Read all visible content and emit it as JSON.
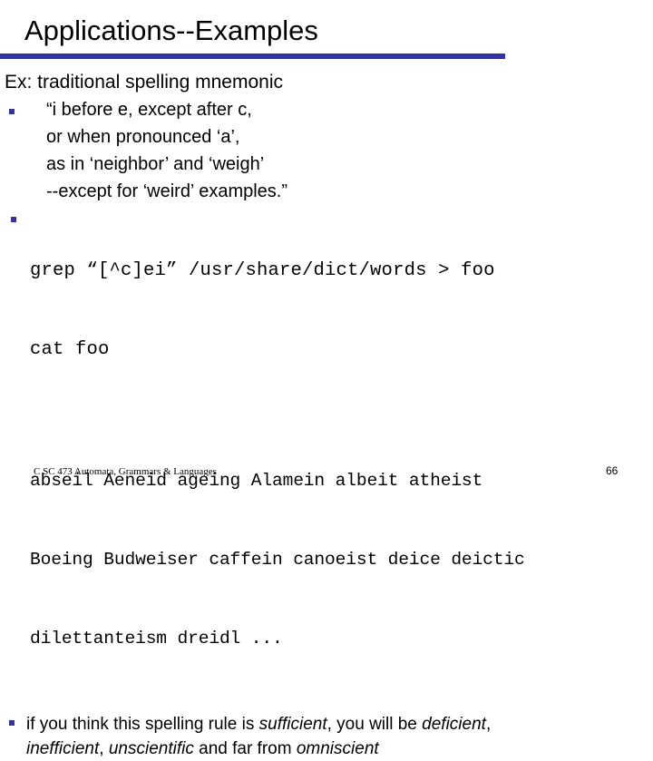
{
  "slide": {
    "title": "Applications--Examples",
    "accent_color": "#3333a6",
    "bullet_color": "#33339c",
    "lead_line": "Ex:  traditional spelling mnemonic",
    "mnemonic_bullet": {
      "line1": "“i before e, except after c,",
      "line2": "or when pronounced ‘a’,",
      "line3": "as in ‘neighbor’ and ‘weigh’",
      "line4": "--except for ‘weird’ examples.”"
    },
    "command_bullet": {
      "line1": "grep “[^c]ei” /usr/share/dict/words > foo",
      "line2": "cat foo"
    },
    "output_words": {
      "line1": "abseil Aeneid ageing Alamein albeit atheist",
      "line2": "Boeing Budweiser caffein canoeist deice deictic",
      "line3": "dilettanteism dreidl ..."
    },
    "closing_bullet": {
      "l1_a": "if you think this spelling rule is ",
      "l1_b": "sufficient",
      "l1_c": ", you will be ",
      "l1_d": "deficient",
      "l1_e": ",",
      "l2_a": "inefficient",
      "l2_b": ", ",
      "l2_c": "unscientific",
      "l2_d": " and far from ",
      "l2_e": "omniscient"
    },
    "footer": "C SC 473 Automata, Grammars & Languages",
    "page_number": "66"
  }
}
